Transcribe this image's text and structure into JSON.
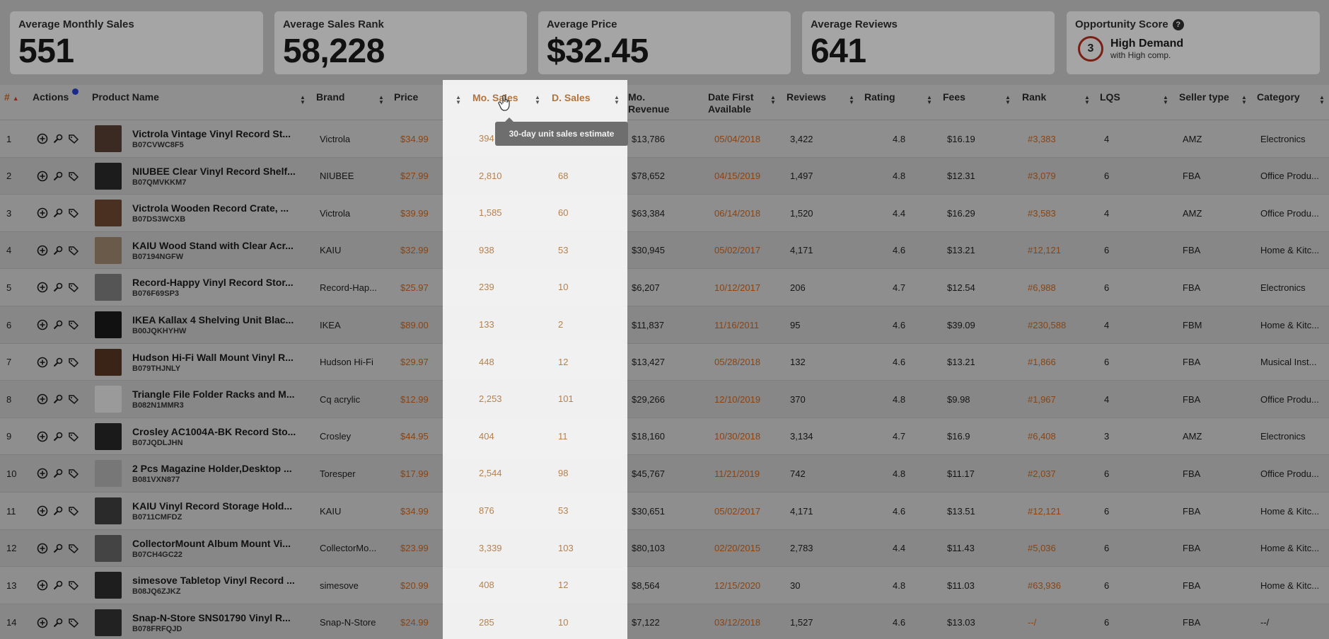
{
  "stats": {
    "avg_monthly_sales": {
      "label": "Average Monthly Sales",
      "value": "551"
    },
    "avg_sales_rank": {
      "label": "Average Sales Rank",
      "value": "58,228"
    },
    "avg_price": {
      "label": "Average Price",
      "value": "$32.45"
    },
    "avg_reviews": {
      "label": "Average Reviews",
      "value": "641"
    },
    "opportunity": {
      "label": "Opportunity Score",
      "help": "?",
      "score": "3",
      "title": "High Demand",
      "subtitle": "with High comp."
    }
  },
  "columns": {
    "index": "#",
    "actions": "Actions",
    "product": "Product Name",
    "brand": "Brand",
    "price": "Price",
    "mo_sales": "Mo. Sales",
    "d_sales": "D. Sales",
    "mo_revenue": "Mo. Revenue",
    "date_first": "Date First Available",
    "reviews": "Reviews",
    "rating": "Rating",
    "fees": "Fees",
    "rank": "Rank",
    "lqs": "LQS",
    "seller_type": "Seller type",
    "category": "Category"
  },
  "tooltip": "30-day unit sales estimate",
  "colors": {
    "accent_orange": "#8a4413",
    "score_ring": "#7a1f14",
    "dot": "#1b2a8a"
  },
  "rows": [
    {
      "n": "1",
      "name": "Victrola Vintage Vinyl Record St...",
      "asin": "B07CVWC8F5",
      "brand": "Victrola",
      "price": "$34.99",
      "mo_sales": "394",
      "d_sales": "",
      "revenue": "$13,786",
      "date": "05/04/2018",
      "reviews": "3,422",
      "rating": "4.8",
      "fees": "$16.19",
      "rank": "#3,383",
      "lqs": "4",
      "seller": "AMZ",
      "category": "Electronics"
    },
    {
      "n": "2",
      "name": "NIUBEE Clear Vinyl Record Shelf...",
      "asin": "B07QMVKKM7",
      "brand": "NIUBEE",
      "price": "$27.99",
      "mo_sales": "2,810",
      "d_sales": "68",
      "revenue": "$78,652",
      "date": "04/15/2019",
      "reviews": "1,497",
      "rating": "4.8",
      "fees": "$12.31",
      "rank": "#3,079",
      "lqs": "6",
      "seller": "FBA",
      "category": "Office Produ..."
    },
    {
      "n": "3",
      "name": "Victrola Wooden Record Crate, ...",
      "asin": "B07DS3WCXB",
      "brand": "Victrola",
      "price": "$39.99",
      "mo_sales": "1,585",
      "d_sales": "60",
      "revenue": "$63,384",
      "date": "06/14/2018",
      "reviews": "1,520",
      "rating": "4.4",
      "fees": "$16.29",
      "rank": "#3,583",
      "lqs": "4",
      "seller": "AMZ",
      "category": "Office Produ..."
    },
    {
      "n": "4",
      "name": "KAIU Wood Stand with Clear Acr...",
      "asin": "B07194NGFW",
      "brand": "KAIU",
      "price": "$32.99",
      "mo_sales": "938",
      "d_sales": "53",
      "revenue": "$30,945",
      "date": "05/02/2017",
      "reviews": "4,171",
      "rating": "4.6",
      "fees": "$13.21",
      "rank": "#12,121",
      "lqs": "6",
      "seller": "FBA",
      "category": "Home & Kitc..."
    },
    {
      "n": "5",
      "name": "Record-Happy Vinyl Record Stor...",
      "asin": "B076F69SP3",
      "brand": "Record-Hap...",
      "price": "$25.97",
      "mo_sales": "239",
      "d_sales": "10",
      "revenue": "$6,207",
      "date": "10/12/2017",
      "reviews": "206",
      "rating": "4.7",
      "fees": "$12.54",
      "rank": "#6,988",
      "lqs": "6",
      "seller": "FBA",
      "category": "Electronics"
    },
    {
      "n": "6",
      "name": "IKEA Kallax 4 Shelving Unit Blac...",
      "asin": "B00JQKHYHW",
      "brand": "IKEA",
      "price": "$89.00",
      "mo_sales": "133",
      "d_sales": "2",
      "revenue": "$11,837",
      "date": "11/16/2011",
      "reviews": "95",
      "rating": "4.6",
      "fees": "$39.09",
      "rank": "#230,588",
      "lqs": "4",
      "seller": "FBM",
      "category": "Home & Kitc..."
    },
    {
      "n": "7",
      "name": "Hudson Hi-Fi Wall Mount Vinyl R...",
      "asin": "B079THJNLY",
      "brand": "Hudson Hi-Fi",
      "price": "$29.97",
      "mo_sales": "448",
      "d_sales": "12",
      "revenue": "$13,427",
      "date": "05/28/2018",
      "reviews": "132",
      "rating": "4.6",
      "fees": "$13.21",
      "rank": "#1,866",
      "lqs": "6",
      "seller": "FBA",
      "category": "Musical Inst..."
    },
    {
      "n": "8",
      "name": "Triangle File Folder Racks and M...",
      "asin": "B082N1MMR3",
      "brand": "Cq acrylic",
      "price": "$12.99",
      "mo_sales": "2,253",
      "d_sales": "101",
      "revenue": "$29,266",
      "date": "12/10/2019",
      "reviews": "370",
      "rating": "4.8",
      "fees": "$9.98",
      "rank": "#1,967",
      "lqs": "4",
      "seller": "FBA",
      "category": "Office Produ..."
    },
    {
      "n": "9",
      "name": "Crosley AC1004A-BK Record Sto...",
      "asin": "B07JQDLJHN",
      "brand": "Crosley",
      "price": "$44.95",
      "mo_sales": "404",
      "d_sales": "11",
      "revenue": "$18,160",
      "date": "10/30/2018",
      "reviews": "3,134",
      "rating": "4.7",
      "fees": "$16.9",
      "rank": "#6,408",
      "lqs": "3",
      "seller": "AMZ",
      "category": "Electronics"
    },
    {
      "n": "10",
      "name": "2 Pcs Magazine Holder,Desktop ...",
      "asin": "B081VXN877",
      "brand": "Toresper",
      "price": "$17.99",
      "mo_sales": "2,544",
      "d_sales": "98",
      "revenue": "$45,767",
      "date": "11/21/2019",
      "reviews": "742",
      "rating": "4.8",
      "fees": "$11.17",
      "rank": "#2,037",
      "lqs": "6",
      "seller": "FBA",
      "category": "Office Produ..."
    },
    {
      "n": "11",
      "name": "KAIU Vinyl Record Storage Hold...",
      "asin": "B0711CMFDZ",
      "brand": "KAIU",
      "price": "$34.99",
      "mo_sales": "876",
      "d_sales": "53",
      "revenue": "$30,651",
      "date": "05/02/2017",
      "reviews": "4,171",
      "rating": "4.6",
      "fees": "$13.51",
      "rank": "#12,121",
      "lqs": "6",
      "seller": "FBA",
      "category": "Home & Kitc..."
    },
    {
      "n": "12",
      "name": "CollectorMount Album Mount Vi...",
      "asin": "B07CH4GC22",
      "brand": "CollectorMo...",
      "price": "$23.99",
      "mo_sales": "3,339",
      "d_sales": "103",
      "revenue": "$80,103",
      "date": "02/20/2015",
      "reviews": "2,783",
      "rating": "4.4",
      "fees": "$11.43",
      "rank": "#5,036",
      "lqs": "6",
      "seller": "FBA",
      "category": "Home & Kitc..."
    },
    {
      "n": "13",
      "name": "simesove Tabletop Vinyl Record ...",
      "asin": "B08JQ6ZJKZ",
      "brand": "simesove",
      "price": "$20.99",
      "mo_sales": "408",
      "d_sales": "12",
      "revenue": "$8,564",
      "date": "12/15/2020",
      "reviews": "30",
      "rating": "4.8",
      "fees": "$11.03",
      "rank": "#63,936",
      "lqs": "6",
      "seller": "FBA",
      "category": "Home & Kitc..."
    },
    {
      "n": "14",
      "name": "Snap-N-Store SNS01790 Vinyl R...",
      "asin": "B078FRFQJD",
      "brand": "Snap-N-Store",
      "price": "$24.99",
      "mo_sales": "285",
      "d_sales": "10",
      "revenue": "$7,122",
      "date": "03/12/2018",
      "reviews": "1,527",
      "rating": "4.6",
      "fees": "$13.03",
      "rank": "--/",
      "lqs": "6",
      "seller": "FBA",
      "category": "--/"
    }
  ]
}
